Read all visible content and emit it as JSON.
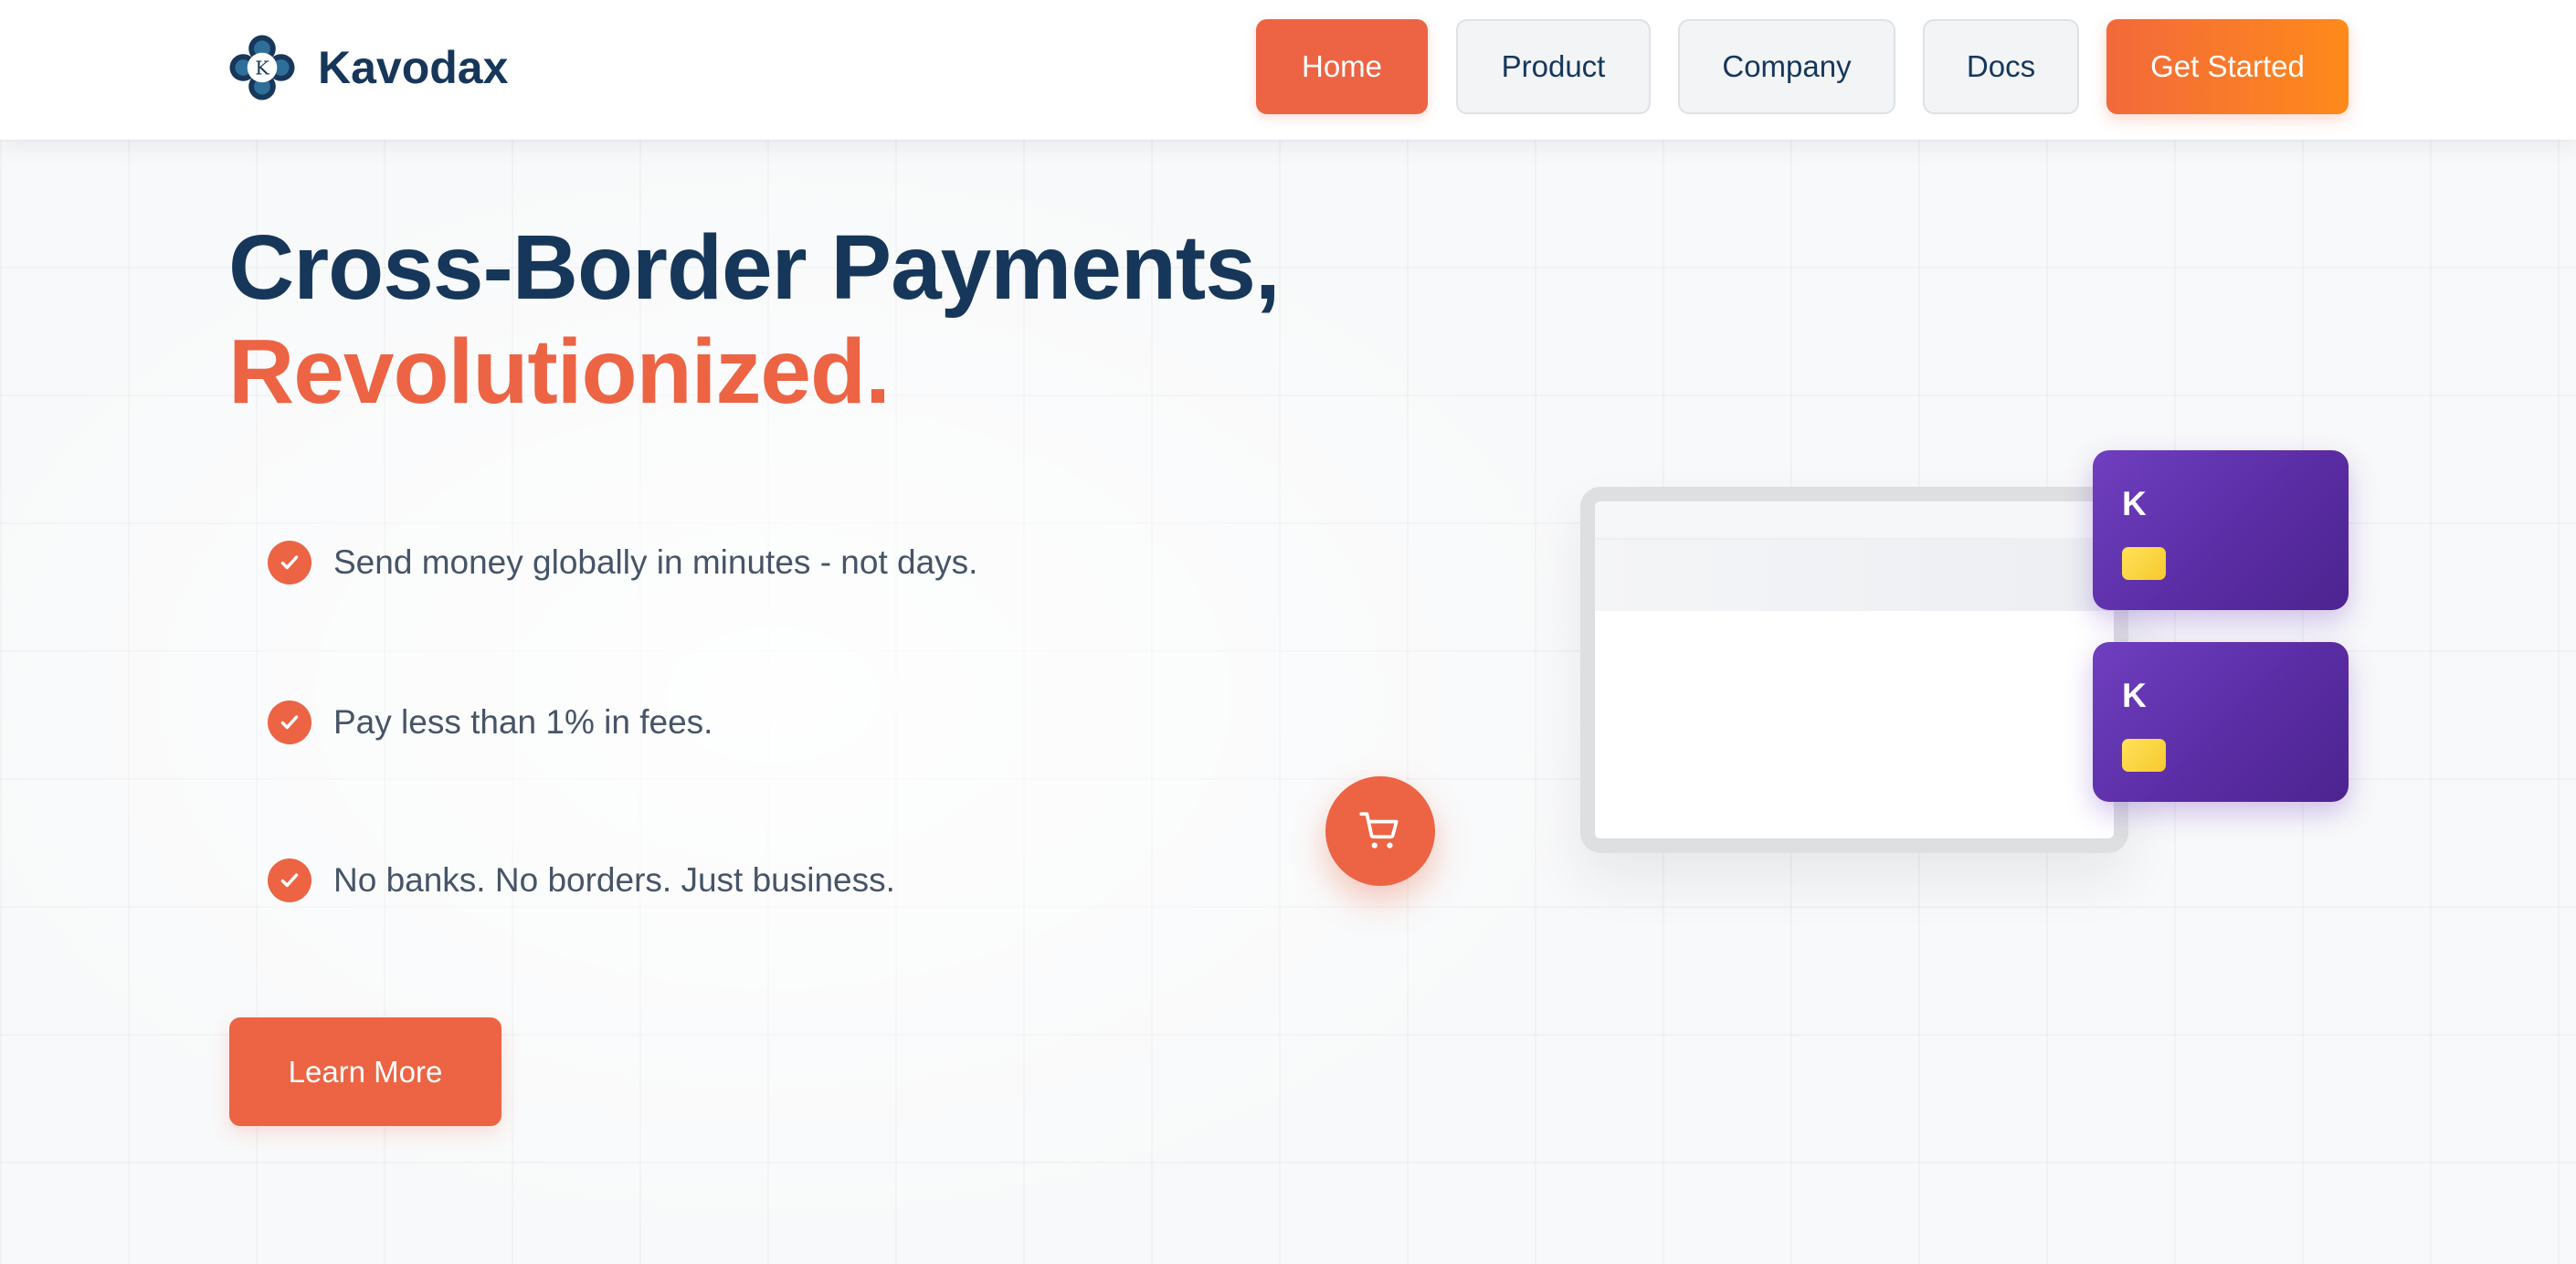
{
  "brand": {
    "name": "Kavodax",
    "logo_letter": "K",
    "logo_icon": "flower-logo-icon"
  },
  "nav": {
    "home": "Home",
    "product": "Product",
    "company": "Company",
    "docs": "Docs",
    "cta": "Get Started"
  },
  "hero": {
    "headline_line1": "Cross-Border Payments,",
    "headline_line2": "Revolutionized.",
    "features": [
      {
        "icon": "check-icon",
        "text": "Send money globally in minutes - not days."
      },
      {
        "icon": "check-icon",
        "text": "Pay less than 1% in fees."
      },
      {
        "icon": "check-icon",
        "text": "No banks. No borders. Just business."
      }
    ],
    "learn_more": "Learn More"
  },
  "illustration": {
    "cart_icon": "shopping-cart-icon",
    "cards": [
      {
        "letter": "K"
      },
      {
        "letter": "K"
      }
    ]
  },
  "colors": {
    "primary": "#ec6443",
    "navy": "#16375a",
    "cta_gradient_start": "#f2693b",
    "cta_gradient_end": "#ff8a1a",
    "card_purple": "#5b2da5",
    "chip_yellow": "#ffe259",
    "body_text": "#475467",
    "background": "#f8f9fa"
  }
}
